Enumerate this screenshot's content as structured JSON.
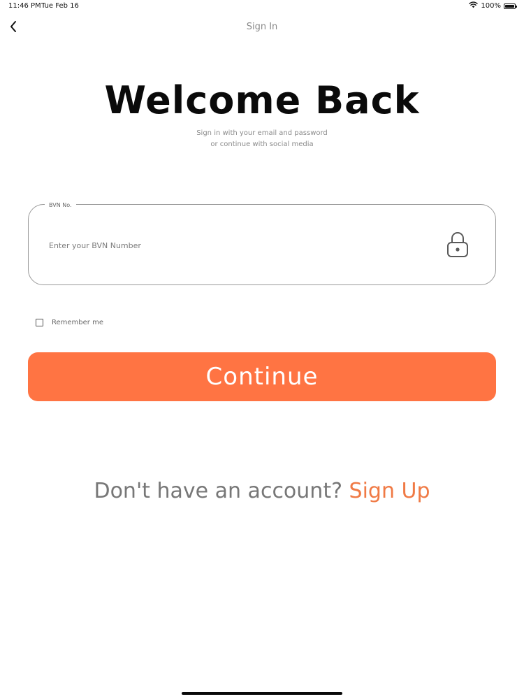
{
  "status_bar": {
    "time": "11:46 PM",
    "date": "Tue Feb 16",
    "battery": "100%",
    "wifi_icon": "wifi-icon",
    "battery_icon": "battery-icon"
  },
  "nav": {
    "title": "Sign In",
    "back_icon": "chevron-left-icon"
  },
  "header": {
    "title": "Welcome Back",
    "subtitle_line1": "Sign in with your email and password",
    "subtitle_line2": "or continue with social media"
  },
  "form": {
    "bvn_label": "BVN No.",
    "bvn_placeholder": "Enter your BVN Number",
    "bvn_value": "",
    "lock_icon": "lock-icon",
    "remember_label": "Remember me",
    "remember_checked": false,
    "continue_label": "Continue"
  },
  "footer": {
    "prompt": "Don't have an account?",
    "signup_label": "Sign Up"
  },
  "colors": {
    "accent": "#ff7443",
    "link": "#f07a45",
    "muted_text": "#8a8a8a",
    "border": "#9a9a9a"
  }
}
